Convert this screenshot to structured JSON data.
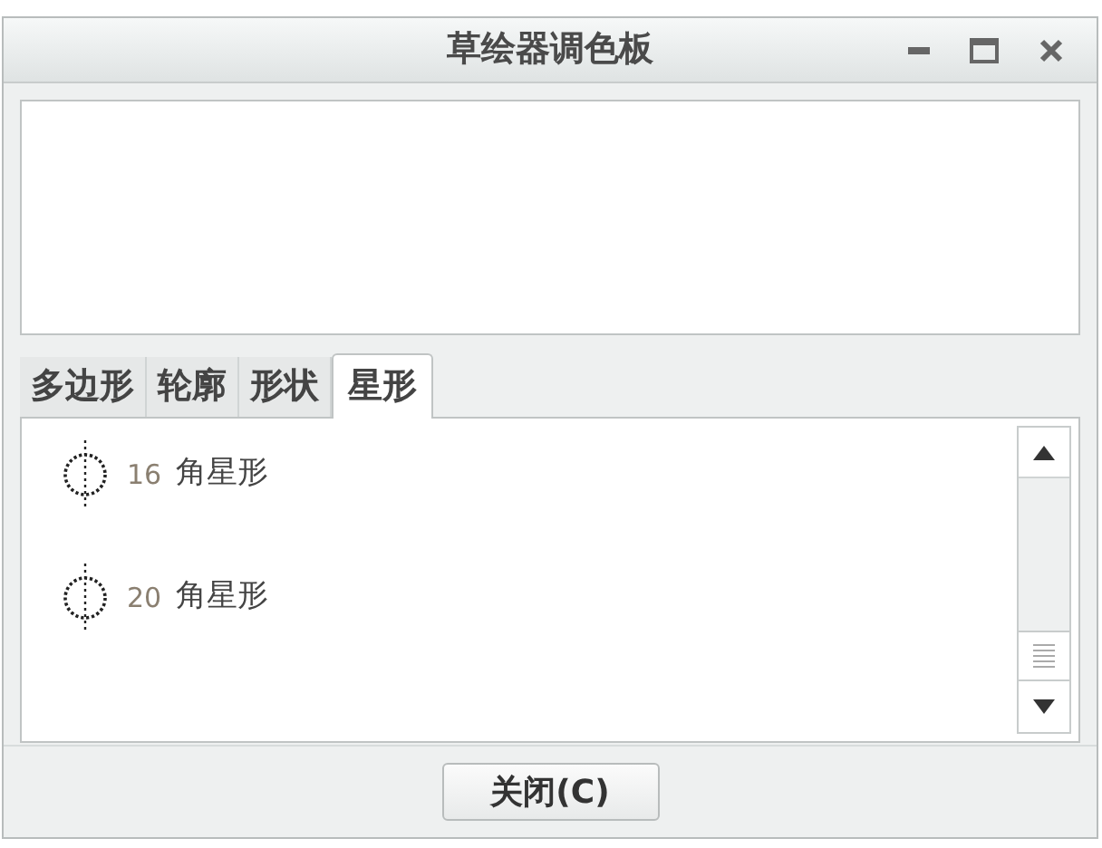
{
  "window": {
    "title": "草绘器调色板"
  },
  "tabs": [
    {
      "label": "多边形",
      "selected": false
    },
    {
      "label": "轮廓",
      "selected": false
    },
    {
      "label": "形状",
      "selected": false
    },
    {
      "label": "星形",
      "selected": true
    }
  ],
  "items": [
    {
      "count": "16",
      "label": "角星形"
    },
    {
      "count": "20",
      "label": "角星形"
    }
  ],
  "buttons": [
    "关闭(C)"
  ]
}
